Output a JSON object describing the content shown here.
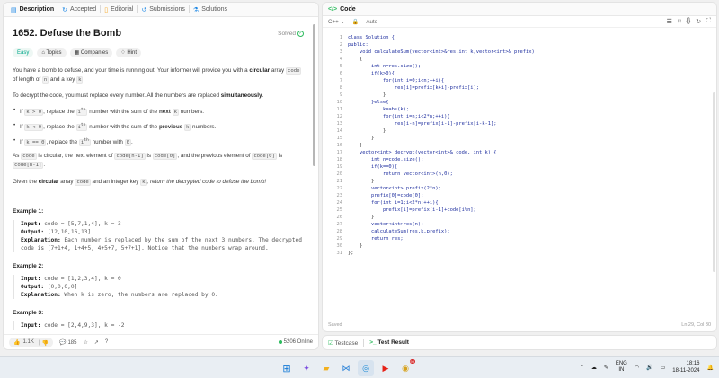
{
  "tabs": [
    {
      "label": "Description",
      "icon": "document-icon"
    },
    {
      "label": "Accepted",
      "icon": "refresh-icon"
    },
    {
      "label": "Editorial",
      "icon": "book-icon"
    },
    {
      "label": "Submissions",
      "icon": "history-icon"
    },
    {
      "label": "Solutions",
      "icon": "flask-icon"
    }
  ],
  "problem": {
    "title": "1652. Defuse the Bomb",
    "status": "Solved",
    "difficulty": "Easy",
    "chips": [
      "Topics",
      "Companies",
      "Hint"
    ],
    "para1": {
      "a": "You have a bomb to defuse, and your time is running out! Your informer will provide you with a ",
      "b": "circular",
      "c": " array ",
      "code1": "code",
      "d": " of length of ",
      "code2": "n",
      "e": " and a key ",
      "code3": "k",
      "f": "."
    },
    "para2": {
      "a": "To decrypt the code, you must replace every number. All the numbers are replaced ",
      "b": "simultaneously",
      "c": "."
    },
    "bullets": [
      {
        "a": "If ",
        "cond": "k > 0",
        "b": ", replace the ",
        "ith": "i",
        "sup": "th",
        "c": " number with the sum of the ",
        "bold": "next",
        "d": " ",
        "kk": "k",
        "e": " numbers."
      },
      {
        "a": "If ",
        "cond": "k < 0",
        "b": ", replace the ",
        "ith": "i",
        "sup": "th",
        "c": " number with the sum of the ",
        "bold": "previous",
        "d": " ",
        "kk": "k",
        "e": " numbers."
      },
      {
        "a": "If ",
        "cond": "k == 0",
        "b": ", replace the ",
        "ith": "i",
        "sup": "th",
        "c": " number with ",
        "zero": "0",
        "e": "."
      }
    ],
    "para3": {
      "a": "As ",
      "c1": "code",
      "b": " is circular, the next element of ",
      "c2": "code[n-1]",
      "c": " is ",
      "c3": "code[0]",
      "d": ", and the previous element of ",
      "c4": "code[0]",
      "e": " is ",
      "c5": "code[n-1]",
      "f": "."
    },
    "para4": {
      "a": "Given the ",
      "b": "circular",
      "c": " array ",
      "c1": "code",
      "d": " and an integer key ",
      "c2": "k",
      "e": ", return the decrypted code to defuse the bomb!"
    },
    "examples": [
      {
        "heading": "Example 1:",
        "input_label": "Input:",
        "input": " code = [5,7,1,4], k = 3",
        "output_label": "Output:",
        "output": " [12,10,16,13]",
        "expl_label": "Explanation:",
        "expl": " Each number is replaced by the sum of the next 3 numbers. The decrypted code is [7+1+4, 1+4+5, 4+5+7, 5+7+1]. Notice that the numbers wrap around."
      },
      {
        "heading": "Example 2:",
        "input_label": "Input:",
        "input": " code = [1,2,3,4], k = 0",
        "output_label": "Output:",
        "output": " [0,0,0,0]",
        "expl_label": "Explanation:",
        "expl": " When k is zero, the numbers are replaced by 0."
      },
      {
        "heading": "Example 3:",
        "input_label": "Input:",
        "input": " code = [2,4,9,3], k = -2"
      }
    ]
  },
  "footer_left": {
    "likes": "1.1K",
    "comments": "185",
    "online": "5206 Online"
  },
  "code_panel": {
    "title": "Code",
    "language": "C++",
    "mode": "Auto",
    "saved": "Saved",
    "cursor": "Ln 29, Col 30",
    "lines": [
      "class Solution {",
      "public:",
      "    void calculateSum(vector<int>&res,int k,vector<int>& prefix)",
      "    {",
      "        int n=res.size();",
      "        if(k>0){",
      "            for(int i=0;i<n;++i){",
      "                res[i]=prefix[k+i]-prefix[i];",
      "            }",
      "        }else{",
      "            k=abs(k);",
      "            for(int i=n;i<2*n;++i){",
      "                res[i-n]=prefix[i-1]-prefix[i-k-1];",
      "            }",
      "        }",
      "    }",
      "    vector<int> decrypt(vector<int>& code, int k) {",
      "        int n=code.size();",
      "        if(k==0){",
      "            return vector<int>(n,0);",
      "        }",
      "        vector<int> prefix(2*n);",
      "        prefix[0]=code[0];",
      "        for(int i=1;i<2*n;++i){",
      "            prefix[i]=prefix[i-1]+code[i%n];",
      "        }",
      "        vector<int>res(n);",
      "        calculateSum(res,k,prefix);",
      "        return res;",
      "    }",
      "};"
    ]
  },
  "bottom_tabs": {
    "testcase": "Testcase",
    "result": "Test Result"
  },
  "taskbar": {
    "lang_top": "ENG",
    "lang_bottom": "IN",
    "time": "18:16",
    "date": "18-11-2024",
    "badge": "99"
  }
}
